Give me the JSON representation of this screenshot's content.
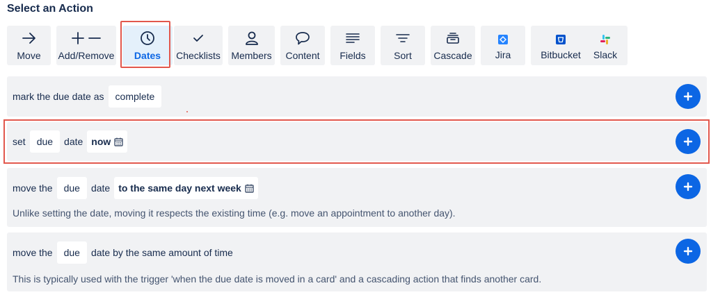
{
  "header": {
    "title": "Select an Action"
  },
  "tabs": [
    {
      "id": "move",
      "label": "Move",
      "icon": "arrow-right-icon"
    },
    {
      "id": "add_remove",
      "label": "Add/Remove",
      "icon": "plus-minus-icon"
    },
    {
      "id": "dates",
      "label": "Dates",
      "icon": "clock-icon",
      "active": true
    },
    {
      "id": "checklists",
      "label": "Checklists",
      "icon": "checkmark-icon"
    },
    {
      "id": "members",
      "label": "Members",
      "icon": "person-icon"
    },
    {
      "id": "content",
      "label": "Content",
      "icon": "speech-bubble-icon"
    },
    {
      "id": "fields",
      "label": "Fields",
      "icon": "lines-icon"
    },
    {
      "id": "sort",
      "label": "Sort",
      "icon": "funnel-lines-icon"
    },
    {
      "id": "cascade",
      "label": "Cascade",
      "icon": "stacked-cards-icon"
    },
    {
      "id": "jira",
      "label": "Jira",
      "icon": "jira-logo-icon"
    },
    {
      "id": "bitbucket",
      "label": "Bitbucket",
      "icon": "bitbucket-logo-icon"
    },
    {
      "id": "slack",
      "label": "Slack",
      "icon": "slack-logo-icon"
    }
  ],
  "actions": {
    "mark_complete": {
      "text": "mark the due date as",
      "status": "complete"
    },
    "set_date": {
      "prefix": "set",
      "field": "due",
      "mid": "date",
      "value": "now"
    },
    "move_date": {
      "prefix": "move the",
      "field": "due",
      "mid": "date",
      "value": "to the same day next week",
      "description": "Unlike setting the date, moving it respects the existing time (e.g. move an appointment to another day)."
    },
    "move_by_amount": {
      "prefix": "move the",
      "field": "due",
      "suffix": "date by the same amount of time",
      "description": "This is typically used with the trigger 'when the due date is moved in a card' and a cascading action that finds another card."
    }
  },
  "colors": {
    "accent": "#0c66e4",
    "highlight": "#e2574c",
    "panel": "#f1f2f4",
    "active_tab": "#e4f0fb",
    "jira": "#2684ff",
    "bitbucket": "#0052cc"
  }
}
